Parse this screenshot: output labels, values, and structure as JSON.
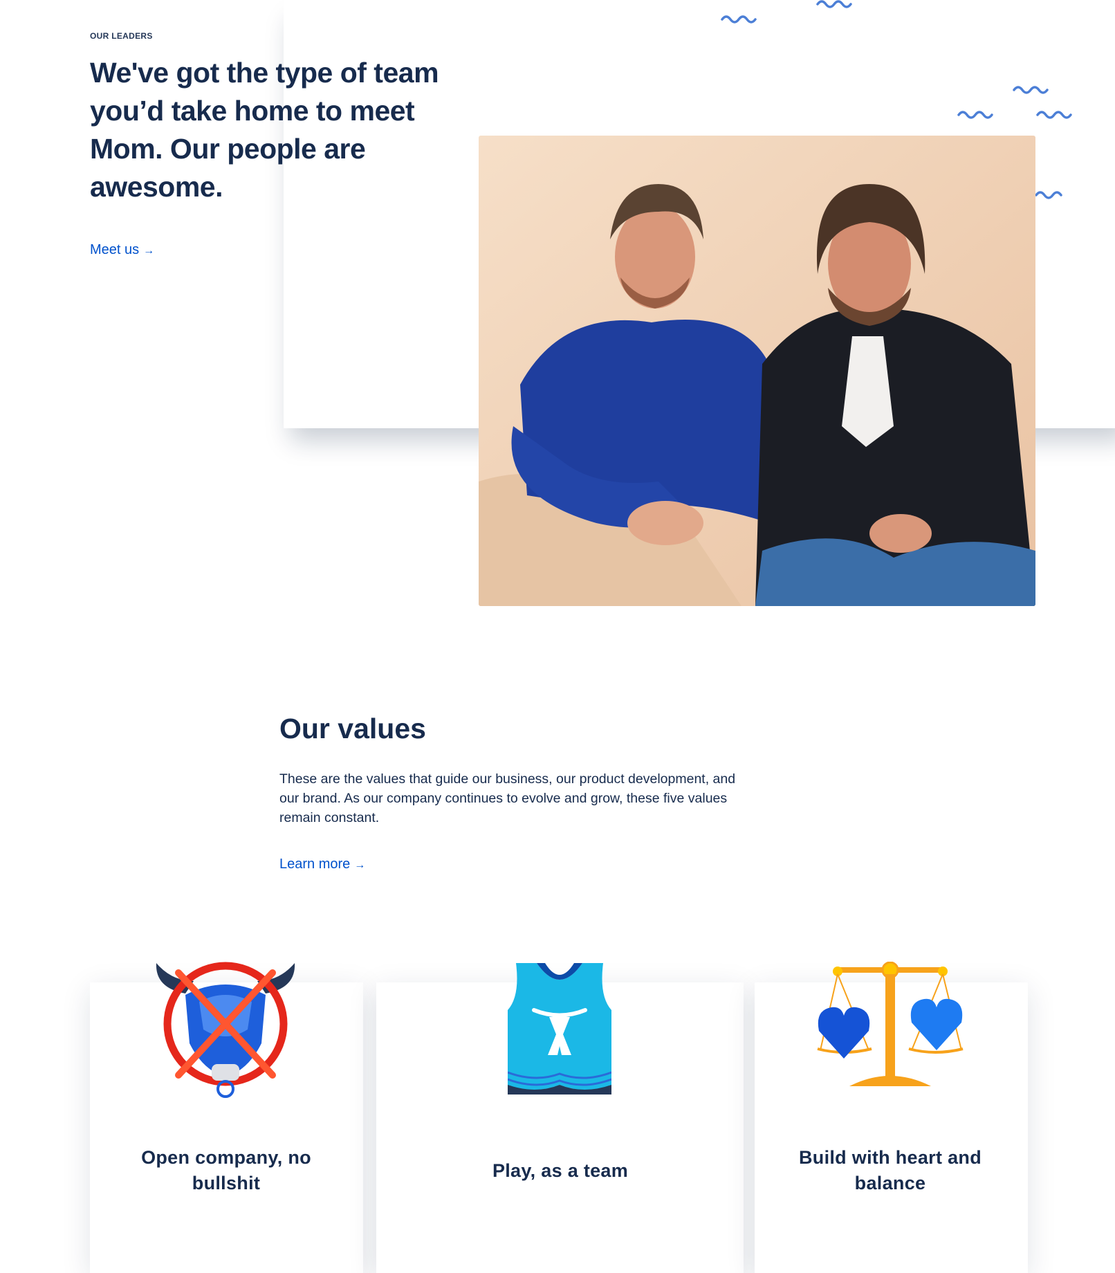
{
  "leaders": {
    "eyebrow": "OUR LEADERS",
    "headline": "We've got the type of team you’d take home to meet Mom. Our people are awesome.",
    "link_label": "Meet us",
    "link_arrow": "→",
    "photo": "two-founders-photo"
  },
  "values": {
    "title": "Our values",
    "description": "These are the values that guide our business, our product development, and our brand. As our company continues to evolve and grow, these five values remain constant.",
    "link_label": "Learn more",
    "link_arrow": "→",
    "items": [
      {
        "label": "Open company, no bullshit",
        "icon": "crossed-out-bull-icon"
      },
      {
        "label": "Play, as a team",
        "icon": "team-jersey-icon"
      },
      {
        "label": "Build with heart and balance",
        "icon": "balance-scale-hearts-icon"
      }
    ]
  },
  "colors": {
    "heading": "#172B4D",
    "link": "#0052CC",
    "squiggle": "#4C7FD6"
  }
}
